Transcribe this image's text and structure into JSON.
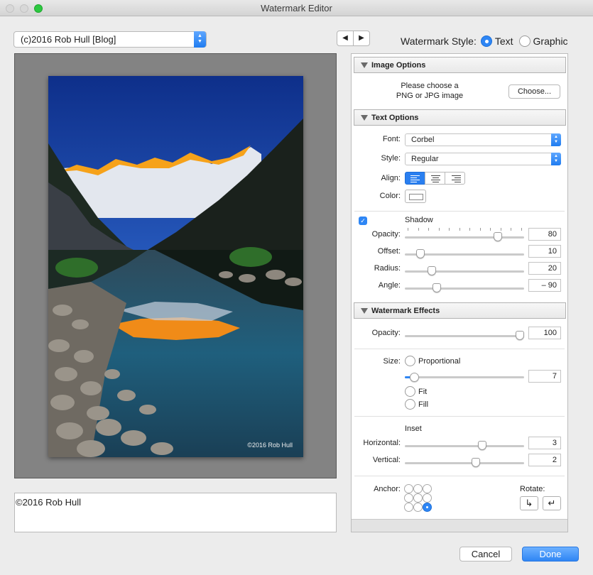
{
  "window": {
    "title": "Watermark Editor"
  },
  "preset": {
    "value": "(c)2016 Rob Hull [Blog]"
  },
  "nav": {
    "prev_glyph": "◀",
    "next_glyph": "▶"
  },
  "style": {
    "label": "Watermark Style:",
    "text_label": "Text",
    "graphic_label": "Graphic",
    "selected": "Text"
  },
  "preview": {
    "watermark_text": "©2016 Rob Hull"
  },
  "entry": {
    "value": "©2016 Rob Hull"
  },
  "image_options": {
    "header": "Image Options",
    "hint_line1": "Please choose a",
    "hint_line2": "PNG or JPG image",
    "choose_label": "Choose..."
  },
  "text_options": {
    "header": "Text Options",
    "font_label": "Font:",
    "font_value": "Corbel",
    "style_label": "Style:",
    "style_value": "Regular",
    "align_label": "Align:",
    "align_selected": "left",
    "color_label": "Color:",
    "shadow_checked": true,
    "shadow_label": "Shadow",
    "shadow": [
      {
        "label": "Opacity:",
        "value": "80"
      },
      {
        "label": "Offset:",
        "value": "10"
      },
      {
        "label": "Radius:",
        "value": "20"
      },
      {
        "label": "Angle:",
        "value": "– 90"
      }
    ]
  },
  "effects": {
    "header": "Watermark Effects",
    "opacity_label": "Opacity:",
    "opacity_value": "100",
    "size_label": "Size:",
    "size_options": [
      "Proportional",
      "Fit",
      "Fill"
    ],
    "size_selected": "Proportional",
    "size_value": "7",
    "inset_label": "Inset",
    "horizontal_label": "Horizontal:",
    "horizontal_value": "3",
    "vertical_label": "Vertical:",
    "vertical_value": "2",
    "anchor_label": "Anchor:",
    "anchor_selected": "bottom-right",
    "rotate_label": "Rotate:",
    "rotate_cw_glyph": "↳",
    "rotate_ccw_glyph": "↵"
  },
  "footer": {
    "cancel_label": "Cancel",
    "done_label": "Done"
  },
  "colors": {
    "accent": "#2e86f5",
    "preview_bg": "#838383"
  },
  "icons": {
    "section_toggle": "disclosure-triangle-icon",
    "stepper": "updown-chevron-icon",
    "align_left": "align-left-icon",
    "align_center": "align-center-icon",
    "align_right": "align-right-icon",
    "check": "checkmark-icon"
  }
}
